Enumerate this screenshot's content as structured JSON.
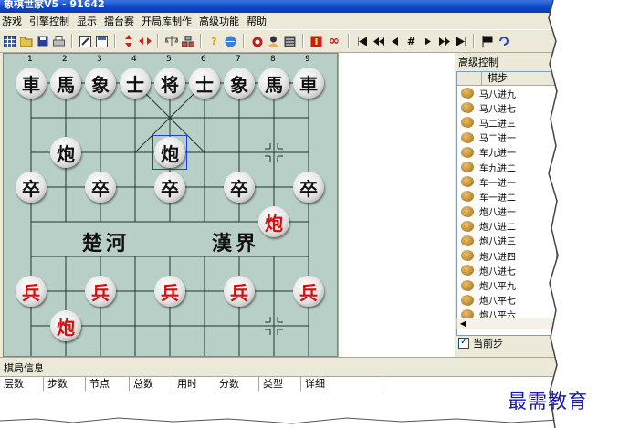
{
  "window": {
    "title": "象棋世家V5 - 91642"
  },
  "menu": [
    "游戏",
    "引擎控制",
    "显示",
    "擂台赛",
    "开局库制作",
    "高级功能",
    "帮助"
  ],
  "toolbar": {
    "icons": [
      "grid-icon",
      "open-folder-icon",
      "save-icon",
      "print-icon",
      "edit-icon",
      "window-icon",
      "flip-vertical-icon",
      "flip-horizontal-icon",
      "balance-icon",
      "network-icon",
      "help-icon",
      "web-icon",
      "engine-icon",
      "player-icon",
      "record-icon",
      "stop-icon",
      "infinity-icon",
      "first-move-icon",
      "fast-back-icon",
      "back-icon",
      "jump-icon",
      "forward-icon",
      "fast-forward-icon",
      "last-move-icon",
      "flag-icon",
      "rotate-icon"
    ],
    "infinity_label": "∞",
    "hash_label": "#"
  },
  "board": {
    "file_numbers": [
      "1",
      "2",
      "3",
      "4",
      "5",
      "6",
      "7",
      "8",
      "9"
    ],
    "river_left": "楚河",
    "river_right": "漢界",
    "pieces": [
      {
        "char": "車",
        "side": "black",
        "file": 0,
        "rank": 0
      },
      {
        "char": "馬",
        "side": "black",
        "file": 1,
        "rank": 0
      },
      {
        "char": "象",
        "side": "black",
        "file": 2,
        "rank": 0
      },
      {
        "char": "士",
        "side": "black",
        "file": 3,
        "rank": 0
      },
      {
        "char": "将",
        "side": "black",
        "file": 4,
        "rank": 0
      },
      {
        "char": "士",
        "side": "black",
        "file": 5,
        "rank": 0
      },
      {
        "char": "象",
        "side": "black",
        "file": 6,
        "rank": 0
      },
      {
        "char": "馬",
        "side": "black",
        "file": 7,
        "rank": 0
      },
      {
        "char": "車",
        "side": "black",
        "file": 8,
        "rank": 0
      },
      {
        "char": "炮",
        "side": "black",
        "file": 1,
        "rank": 2
      },
      {
        "char": "炮",
        "side": "black",
        "file": 4,
        "rank": 2
      },
      {
        "char": "卒",
        "side": "black",
        "file": 0,
        "rank": 3
      },
      {
        "char": "卒",
        "side": "black",
        "file": 2,
        "rank": 3
      },
      {
        "char": "卒",
        "side": "black",
        "file": 4,
        "rank": 3
      },
      {
        "char": "卒",
        "side": "black",
        "file": 6,
        "rank": 3
      },
      {
        "char": "卒",
        "side": "black",
        "file": 8,
        "rank": 3
      },
      {
        "char": "炮",
        "side": "red",
        "file": 7,
        "rank": 4
      },
      {
        "char": "兵",
        "side": "red",
        "file": 0,
        "rank": 6
      },
      {
        "char": "兵",
        "side": "red",
        "file": 2,
        "rank": 6
      },
      {
        "char": "兵",
        "side": "red",
        "file": 4,
        "rank": 6
      },
      {
        "char": "兵",
        "side": "red",
        "file": 6,
        "rank": 6
      },
      {
        "char": "兵",
        "side": "red",
        "file": 8,
        "rank": 6
      },
      {
        "char": "炮",
        "side": "red",
        "file": 1,
        "rank": 7
      }
    ],
    "selected": {
      "file": 4,
      "rank": 2
    }
  },
  "advanced_control": {
    "title": "高级控制",
    "column_header": "棋步",
    "moves": [
      "马八进九",
      "马八进七",
      "马二进三",
      "马二进一",
      "车九进一",
      "车九进二",
      "车一进一",
      "车一进二",
      "炮八进一",
      "炮八进二",
      "炮八进三",
      "炮八进四",
      "炮八进七",
      "炮八平九",
      "炮八平七",
      "炮八平六"
    ],
    "current_step_label": "当前步",
    "current_step_checked": "✓"
  },
  "game_info": {
    "title": "棋局信息",
    "columns": [
      "层数",
      "步数",
      "节点",
      "总数",
      "用时",
      "分数",
      "类型",
      "详细"
    ]
  },
  "watermark": "最需教育",
  "colors": {
    "red_piece": "#d01010",
    "black_piece": "#111111",
    "selection": "#1f3fe0",
    "title_bar": "#0a46c8"
  }
}
